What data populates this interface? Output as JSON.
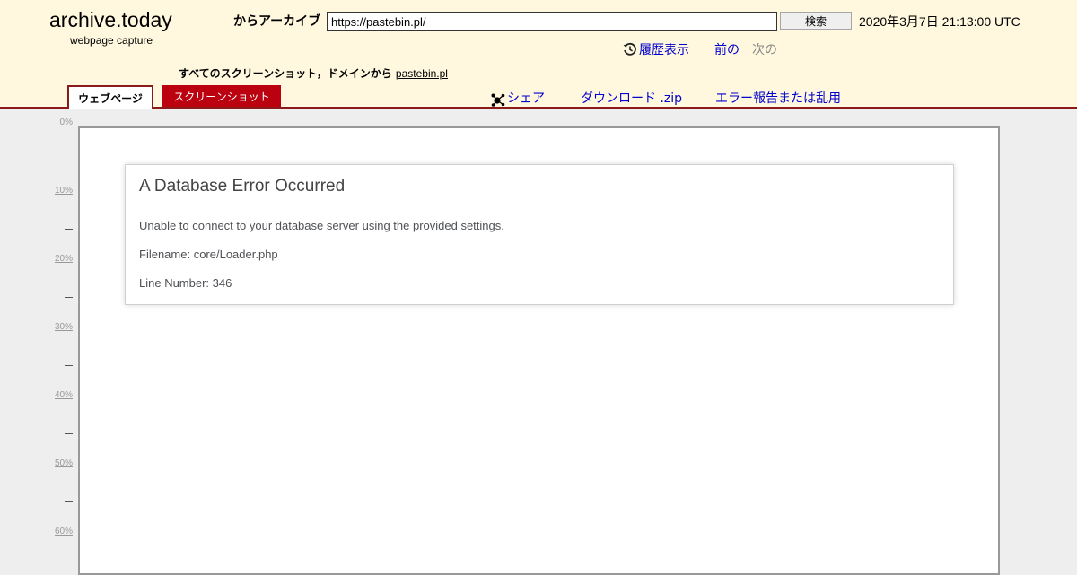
{
  "brand": {
    "title": "archive.today",
    "subtitle": "webpage capture"
  },
  "toolbar": {
    "archive_label": "からアーカイブ",
    "url_value": "https://pastebin.pl/",
    "search_label": "検索",
    "capture_date": "2020年3月7日 21:13:00 UTC"
  },
  "nav": {
    "history_label": "履歴表示",
    "prev_label": "前の",
    "next_label": "次の",
    "history_icon": "history-clock-icon"
  },
  "screenshots_row": {
    "text": "すべてのスクリーンショット，ドメインから",
    "domain_link": "pastebin.pl"
  },
  "tabs": [
    {
      "label": "ウェブページ",
      "active": true
    },
    {
      "label": "スクリーンショット",
      "active": false
    }
  ],
  "actions": {
    "share_label": "シェア",
    "share_icon": "share-nodes-icon",
    "download_label": "ダウンロード .zip",
    "report_label": "エラー報告または乱用"
  },
  "ruler": {
    "labels": [
      "0%",
      "10%",
      "20%",
      "30%",
      "40%",
      "50%",
      "60%"
    ]
  },
  "content": {
    "heading": "A Database Error Occurred",
    "message": "Unable to connect to your database server using the provided settings.",
    "filename": "Filename: core/Loader.php",
    "line_number": "Line Number: 346"
  },
  "colors": {
    "header_bg": "#fff8df",
    "accent": "#bb0010",
    "link": "#0000cc",
    "page_bg": "#eeeeee"
  }
}
